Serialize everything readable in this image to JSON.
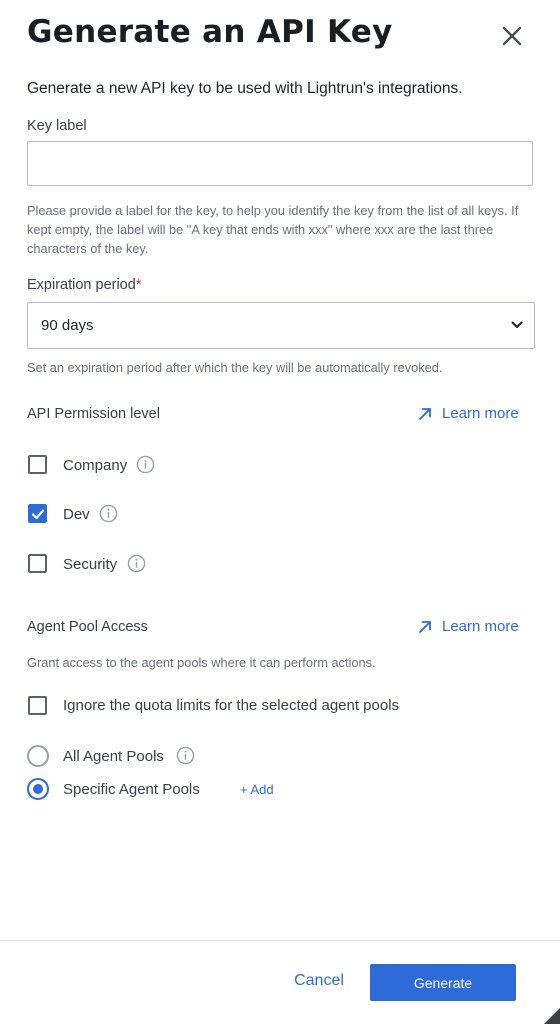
{
  "dialog": {
    "title": "Generate an API Key",
    "subtitle": "Generate a new API key to be used with Lightrun's integrations."
  },
  "key_label": {
    "label": "Key label",
    "value": "",
    "placeholder": "",
    "help": "Please provide a label for the key, to help you identify the key from the list of all keys. If kept empty, the label will be \"A key that ends with xxx\" where xxx are the last three characters of the key."
  },
  "expiration": {
    "label": "Expiration period",
    "required_mark": "*",
    "selected": "90 days",
    "help": "Set an expiration period after which the key will be automatically revoked."
  },
  "permissions": {
    "label": "API Permission level",
    "learn_more": "Learn more",
    "options": [
      {
        "label": "Company",
        "checked": false
      },
      {
        "label": "Dev",
        "checked": true
      },
      {
        "label": "Security",
        "checked": false
      }
    ]
  },
  "agent_pool": {
    "label": "Agent Pool Access",
    "learn_more": "Learn more",
    "help": "Grant access to the agent pools where it can perform actions.",
    "ignore_quota": {
      "label": "Ignore the quota limits for the selected agent pools",
      "checked": false
    },
    "radios": [
      {
        "label": "All Agent Pools",
        "selected": false
      },
      {
        "label": "Specific Agent Pools",
        "selected": true
      }
    ],
    "add_label": "+ Add"
  },
  "footer": {
    "cancel_label": "Cancel",
    "generate_label": "Generate"
  },
  "colors": {
    "accent": "#2f6bd8",
    "required": "#dd3333"
  }
}
